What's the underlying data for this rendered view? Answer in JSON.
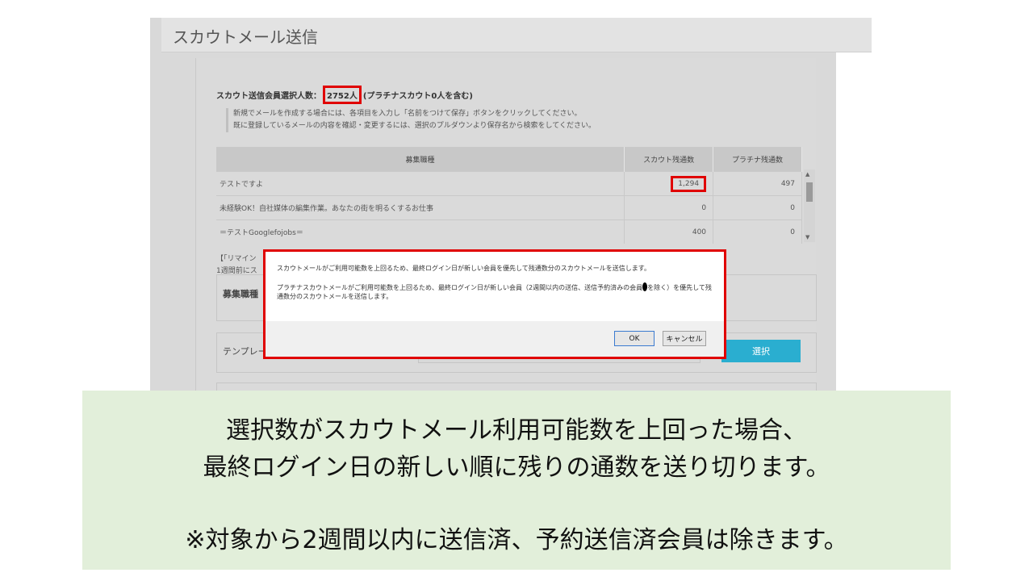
{
  "page": {
    "title": "スカウトメール送信",
    "count_prefix": "スカウト送信会員選択人数：",
    "count_value": "2752人",
    "count_suffix": "(プラチナスカウト0人を含む)",
    "note_line1": "新規でメールを作成する場合には、各項目を入力し「名前をつけて保存」ボタンをクリックしてください。",
    "note_line2": "既に登録しているメールの内容を確認・変更するには、選択のプルダウンより保存名から検索をしてください。"
  },
  "table": {
    "headers": [
      "募集職種",
      "スカウト残通数",
      "プラチナ残通数"
    ],
    "rows": [
      {
        "name": "テストですよ",
        "scout": "1,294",
        "platinum": "497"
      },
      {
        "name": "未経験OK！自社媒体の編集作業。あなたの街を明るくするお仕事",
        "scout": "0",
        "platinum": "0"
      },
      {
        "name": "＝テストGooglefojobs＝",
        "scout": "400",
        "platinum": "0"
      }
    ]
  },
  "behind": {
    "bracket_line1": "【「リマイン",
    "bracket_line2": "1週間前にス",
    "jobtype_label": "募集職種",
    "template_label": "テンプレー",
    "select_button": "選択"
  },
  "dialog": {
    "message1": "スカウトメールがご利用可能数を上回るため、最終ログイン日が新しい会員を優先して残通数分のスカウトメールを送信します。",
    "message2a": "プラチナスカウトメールがご利用可能数を上回るため、最終ログイン日が新しい会員（2週間以内の送信、送信予約済みの会員",
    "message2b": "を除く）を優先して残通数分のスカウトメールを送信します。",
    "ok": "OK",
    "cancel": "キャンセル"
  },
  "caption": {
    "line1": "選択数がスカウトメール利用可能数を上回った場合、",
    "line2": "最終ログイン日の新しい順に残りの通数を送り切ります。",
    "line3": "※対象から2週間以内に送信済、予約送信済会員は除きます。"
  },
  "colors": {
    "highlight": "#e00000",
    "select_button": "#2aaed0",
    "caption_bg": "#e2efda"
  }
}
